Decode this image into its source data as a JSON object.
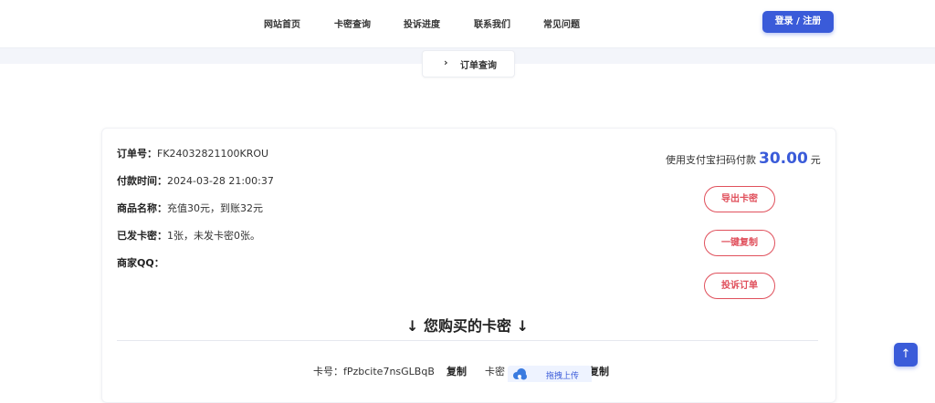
{
  "nav": {
    "items": [
      "网站首页",
      "卡密查询",
      "投诉进度",
      "联系我们",
      "常见问题"
    ],
    "login_label": "登录 / 注册"
  },
  "breadcrumb": {
    "chevron": "›",
    "label": "订单查询"
  },
  "order": {
    "order_no_key": "订单号：",
    "order_no": "FK24032821100KROU",
    "pay_time_key": "付款时间：",
    "pay_time": "2024-03-28 21:00:37",
    "product_key": "商品名称：",
    "product": "充值30元，到账32元",
    "issued_key": "已发卡密：",
    "issued": "1张，未发卡密0张。",
    "merchant_qq_key": "商家QQ：",
    "merchant_qq": ""
  },
  "payment": {
    "prefix": "使用支付宝扫码付款",
    "amount": "30.00",
    "suffix": "元"
  },
  "actions": {
    "export": "导出卡密",
    "copy_all": "一键复制",
    "complain": "投诉订单"
  },
  "cards_section": {
    "title": "↓  您购买的卡密  ↓"
  },
  "card_item": {
    "card_label": "卡号：fPzbcite7nsGLBqB",
    "copy1": "复制",
    "secret_label": "卡密",
    "copy2": "复制"
  },
  "upload": {
    "label": "拖拽上传",
    "icon": "cloud-upload-icon"
  },
  "back_to_top": {
    "icon": "arrow-up-icon",
    "glyph": "↑"
  },
  "colors": {
    "accent": "#3a5bd9",
    "danger": "#e0505c"
  }
}
